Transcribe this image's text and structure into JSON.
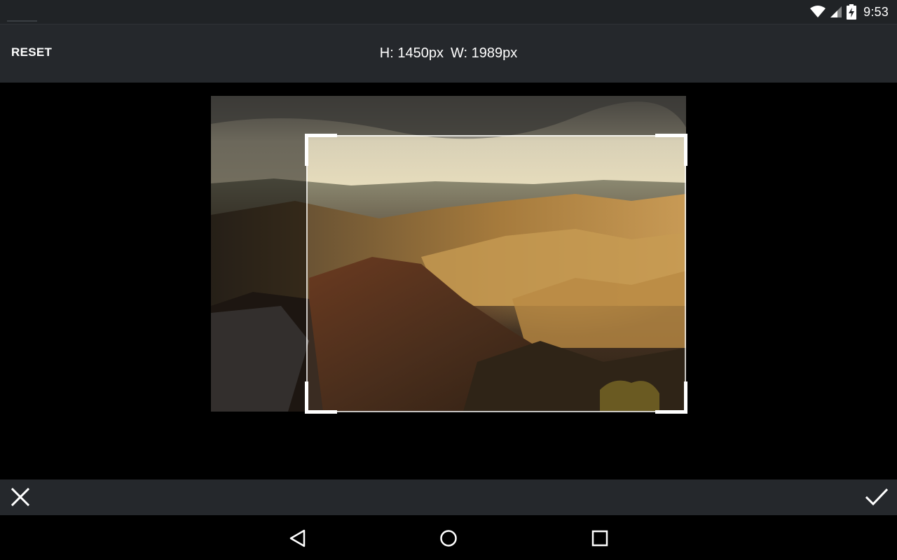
{
  "status_bar": {
    "time": "9:53",
    "icons": [
      "wifi-icon",
      "cellular-signal-icon",
      "battery-charging-icon"
    ]
  },
  "toolbar": {
    "reset_label": "RESET",
    "height_label": "H: 1450px",
    "width_label": "W: 1989px"
  },
  "editor": {
    "image_subject": "canyon-landscape-photo"
  },
  "action_bar": {
    "cancel_icon": "close-icon",
    "confirm_icon": "checkmark-icon"
  },
  "nav_bar": {
    "icons": [
      "back-icon",
      "home-icon",
      "recents-icon"
    ]
  },
  "colors": {
    "bar_background": "#25282c",
    "status_background": "#202326",
    "canvas_background": "#000000",
    "crop_handle": "#ffffff"
  }
}
